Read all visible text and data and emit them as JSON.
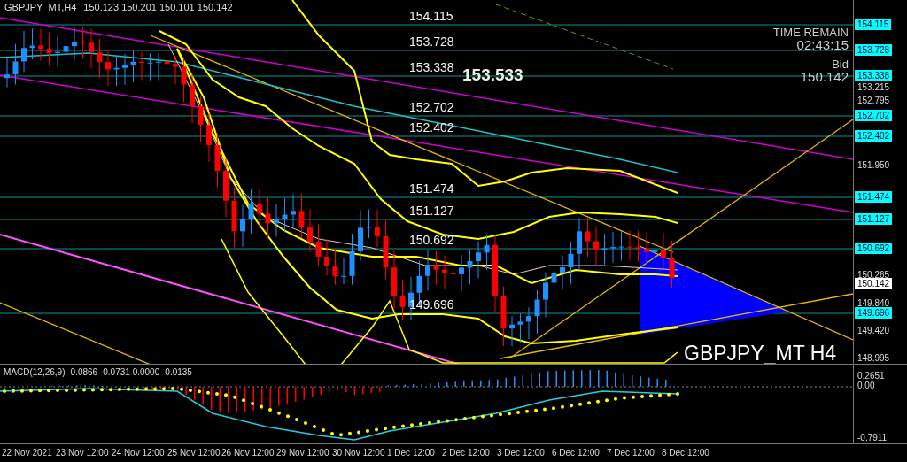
{
  "header": {
    "symbol": "GBPJPY_MT,H4",
    "ohlc": "150.123 150.201 150.101 150.142"
  },
  "info": {
    "time_remain_label": "TIME REMAIN",
    "time_remain": "02:43:15",
    "bid_label": "Bid",
    "bid": "150.142"
  },
  "big_price": "153.533",
  "chart_label": "GBPJPY_MT H4",
  "levels": [
    {
      "label": "154.115",
      "axis_label": "154.115"
    },
    {
      "label": "153.728",
      "axis_label": "153.728"
    },
    {
      "label": "153.338",
      "axis_label": "153.338"
    },
    {
      "label": "152.702",
      "axis_label": "152.702"
    },
    {
      "label": "152.402",
      "axis_label": "152.402"
    },
    {
      "label": "151.474",
      "axis_label": "151.474"
    },
    {
      "label": "151.127",
      "axis_label": "151.127"
    },
    {
      "label": "150.692",
      "axis_label": "150.692"
    },
    {
      "label": "149.696",
      "axis_label": "149.696"
    }
  ],
  "price_axis": [
    "153.215",
    "152.795",
    "151.950",
    "150.265",
    "149.840",
    "149.420",
    "148.995"
  ],
  "current_price": "150.142",
  "macd": {
    "label": "MACD(12,26,9) -0.0866 -0.0731 0.0000 -0.0135",
    "axis": [
      "0.2651",
      "0.00",
      "-0.7911"
    ]
  },
  "time_axis": [
    "22 Nov 2021",
    "23 Nov 12:00",
    "24 Nov 12:00",
    "25 Nov 12:00",
    "26 Nov 12:00",
    "29 Nov 12:00",
    "30 Nov 12:00",
    "1 Dec 12:00",
    "2 Dec 12:00",
    "3 Dec 12:00",
    "6 Dec 12:00",
    "7 Dec 12:00",
    "8 Dec 12:00"
  ]
}
